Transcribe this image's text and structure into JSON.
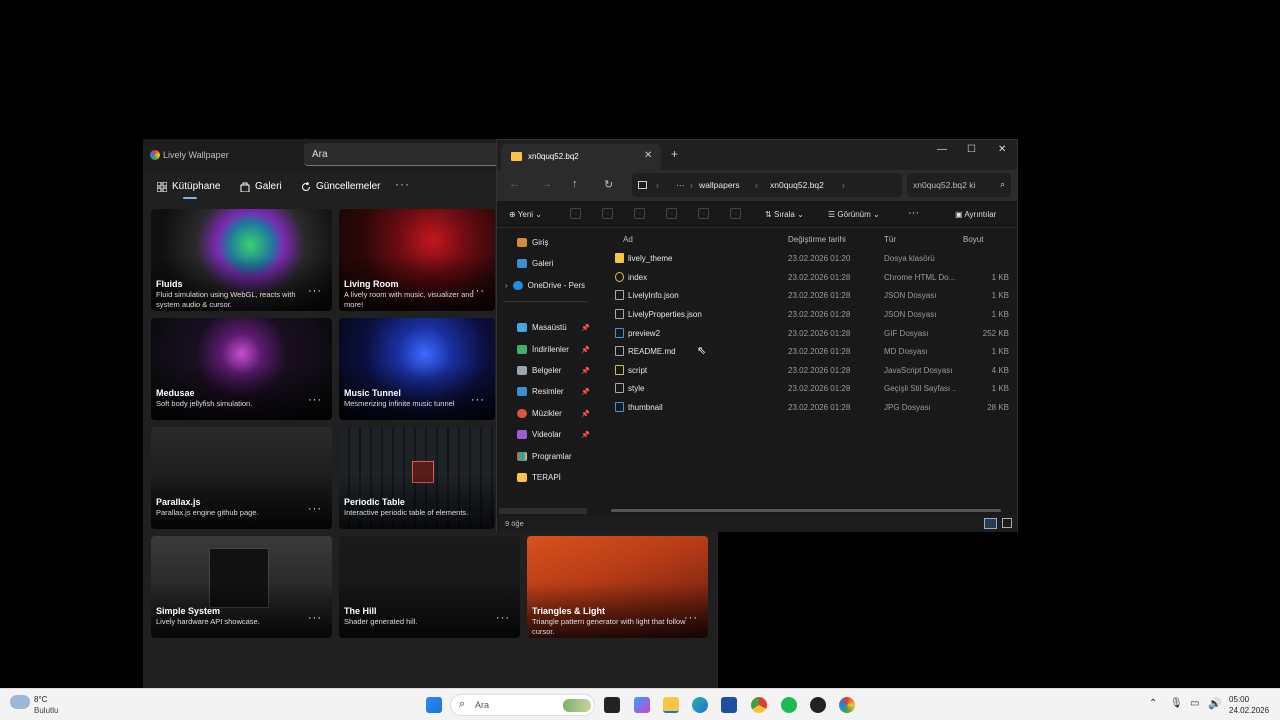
{
  "lively": {
    "title": "Lively Wallpaper",
    "search_placeholder": "Ara",
    "nav": {
      "library": "Kütüphane",
      "gallery": "Galeri",
      "updates": "Güncellemeler",
      "more": "···"
    },
    "cards": [
      {
        "title": "Fluids",
        "desc": "Fluid simulation using WebGL, reacts with system audio & cursor."
      },
      {
        "title": "Living Room",
        "desc": "A lively room with music, visualizer and more!"
      },
      {
        "title": "Medusae",
        "desc": "Soft body jellyfish simulation."
      },
      {
        "title": "Music Tunnel",
        "desc": "Mesmerizing infinite music tunnel"
      },
      {
        "title": "Parallax.js",
        "desc": "Parallax.js engine github page."
      },
      {
        "title": "Periodic Table",
        "desc": "Interactive periodic table of elements."
      },
      {
        "title": "Simple System",
        "desc": "Lively hardware API showcase."
      },
      {
        "title": "The Hill",
        "desc": "Shader generated hill."
      },
      {
        "title": "Triangles & Light",
        "desc": "Triangle pattern generator with light that follow cursor."
      }
    ],
    "card_more": "···"
  },
  "explorer": {
    "tab_title": "xn0quq52.bq2",
    "new_tab": "+",
    "window": {
      "minimize": "—",
      "maximize": "☐",
      "close": "✕"
    },
    "address": {
      "ellipsis": "···",
      "segment1": "wallpapers",
      "segment2": "xn0quq52.bq2"
    },
    "search_placeholder": "xn0quq52.bq2 ki",
    "toolbar": {
      "new": "Yeni",
      "sort": "Sırala",
      "view": "Görünüm",
      "more": "···",
      "details": "Ayrıntılar"
    },
    "sidebar": [
      {
        "label": "Giriş",
        "pinned": false
      },
      {
        "label": "Galeri",
        "pinned": false
      },
      {
        "label": "OneDrive - Pers",
        "pinned": false
      },
      {
        "label": "Masaüstü",
        "pinned": true
      },
      {
        "label": "İndirilenler",
        "pinned": true
      },
      {
        "label": "Belgeler",
        "pinned": true
      },
      {
        "label": "Resimler",
        "pinned": true
      },
      {
        "label": "Müzikler",
        "pinned": true
      },
      {
        "label": "Videolar",
        "pinned": true
      },
      {
        "label": "Programlar",
        "pinned": false
      },
      {
        "label": "TERAPİ",
        "pinned": false
      }
    ],
    "columns": {
      "name": "Ad",
      "date": "Değiştirme tarihi",
      "type": "Tür",
      "size": "Boyut"
    },
    "files": [
      {
        "name": "lively_theme",
        "date": "23.02.2026 01:20",
        "type": "Dosya klasörü",
        "size": ""
      },
      {
        "name": "index",
        "date": "23.02.2026 01:28",
        "type": "Chrome HTML Do...",
        "size": "1 KB"
      },
      {
        "name": "LivelyInfo.json",
        "date": "23.02.2026 01:28",
        "type": "JSON Dosyası",
        "size": "1 KB"
      },
      {
        "name": "LivelyProperties.json",
        "date": "23.02.2026 01:28",
        "type": "JSON Dosyası",
        "size": "1 KB"
      },
      {
        "name": "preview2",
        "date": "23.02.2026 01:28",
        "type": "GIF Dosyası",
        "size": "252 KB"
      },
      {
        "name": "README.md",
        "date": "23.02.2026 01:28",
        "type": "MD Dosyası",
        "size": "1 KB"
      },
      {
        "name": "script",
        "date": "23.02.2026 01:28",
        "type": "JavaScript Dosyası",
        "size": "4 KB"
      },
      {
        "name": "style",
        "date": "23.02.2026 01:28",
        "type": "Geçişli Stil Sayfası ...",
        "size": "1 KB"
      },
      {
        "name": "thumbnail",
        "date": "23.02.2026 01:28",
        "type": "JPG Dosyası",
        "size": "28 KB"
      }
    ],
    "status": "9 öğe"
  },
  "taskbar": {
    "weather_temp": "8°C",
    "weather_desc": "Bulutlu",
    "search": "Ara",
    "time": "05:00",
    "date": "24.02.2026"
  }
}
